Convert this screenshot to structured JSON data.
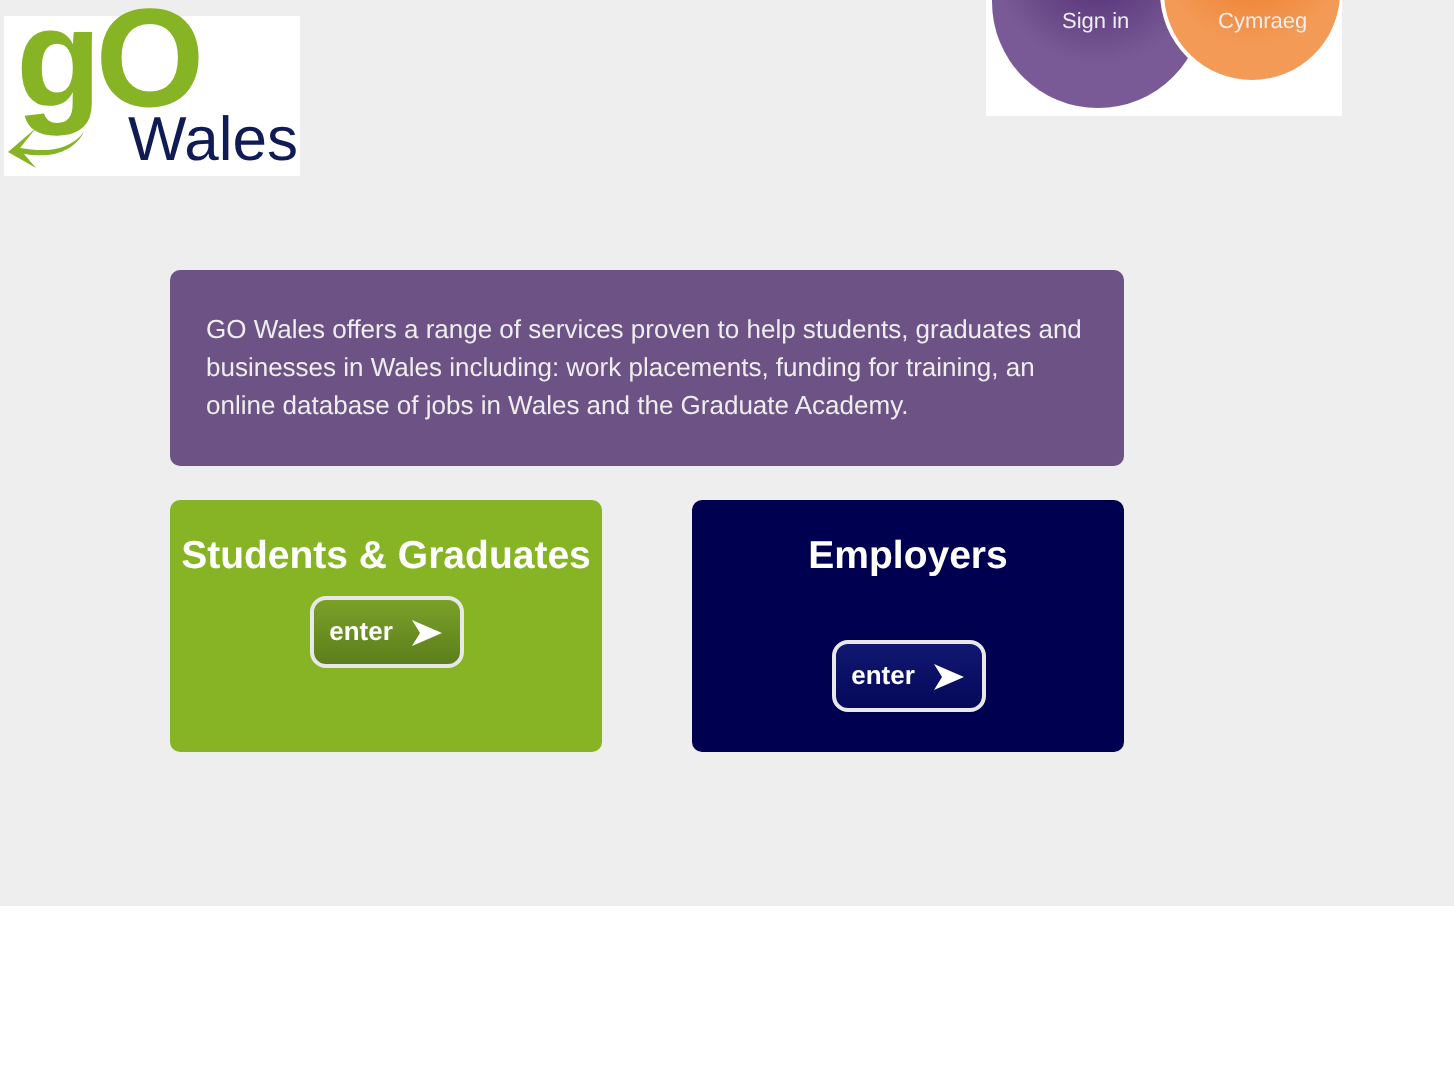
{
  "logo": {
    "mark": "gO",
    "name": "Wales"
  },
  "top_links": [
    {
      "label": "Sign in",
      "kind": "purple"
    },
    {
      "label": "Cymraeg",
      "kind": "orange"
    }
  ],
  "intro": "GO Wales offers a range of services proven to help students, graduates and businesses in Wales including: work placements, funding for training, an online database of jobs in Wales and the Graduate Academy.",
  "sections": [
    {
      "title": "Students & Graduates",
      "button": "enter",
      "kind": "green"
    },
    {
      "title": "Employers",
      "button": "enter",
      "kind": "navy"
    }
  ]
}
